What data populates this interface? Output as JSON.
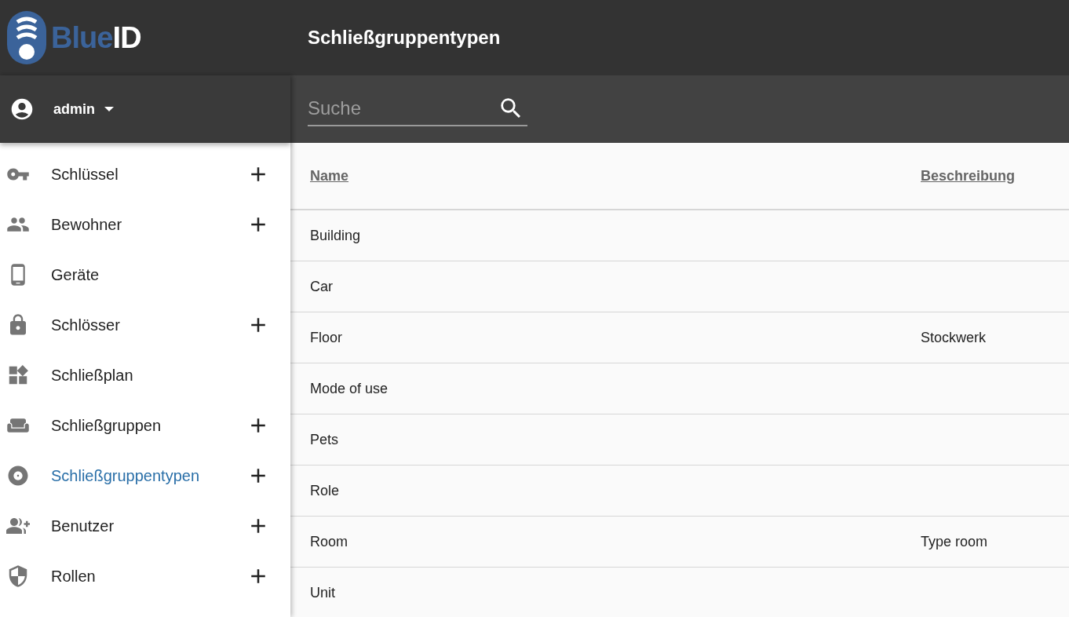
{
  "logo": {
    "part_1": "Blue",
    "part_2": "ID"
  },
  "header": {
    "title": "Schließgruppentypen"
  },
  "user": {
    "name": "admin"
  },
  "search": {
    "placeholder": "Suche"
  },
  "nav": [
    {
      "label": "Schlüssel",
      "add": true,
      "selected": false
    },
    {
      "label": "Bewohner",
      "add": true,
      "selected": false
    },
    {
      "label": "Geräte",
      "add": false,
      "selected": false
    },
    {
      "label": "Schlösser",
      "add": true,
      "selected": false
    },
    {
      "label": "Schließplan",
      "add": false,
      "selected": false
    },
    {
      "label": "Schließgruppen",
      "add": true,
      "selected": false
    },
    {
      "label": "Schließgruppentypen",
      "add": true,
      "selected": true
    },
    {
      "label": "Benutzer",
      "add": true,
      "selected": false
    },
    {
      "label": "Rollen",
      "add": true,
      "selected": false
    }
  ],
  "table": {
    "columns": [
      "Name",
      "Beschreibung"
    ],
    "rows": [
      [
        "Building",
        ""
      ],
      [
        "Car",
        ""
      ],
      [
        "Floor",
        "Stockwerk"
      ],
      [
        "Mode of use",
        ""
      ],
      [
        "Pets",
        ""
      ],
      [
        "Role",
        ""
      ],
      [
        "Room",
        "Type room"
      ],
      [
        "Unit",
        ""
      ]
    ]
  }
}
